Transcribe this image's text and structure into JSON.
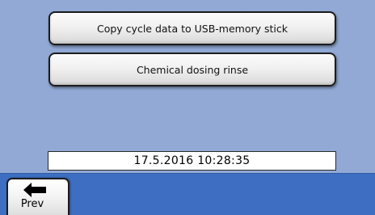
{
  "menu": {
    "copy_label": "Copy cycle data to USB-memory stick",
    "dosing_label": "Chemical dosing rinse"
  },
  "status": {
    "datetime": "17.5.2016 10:28:35"
  },
  "nav": {
    "prev_label": "Prev",
    "prev_icon": "arrow-left-icon"
  },
  "colors": {
    "background": "#91a9d4",
    "bottom_bar": "#3d6ec2"
  }
}
